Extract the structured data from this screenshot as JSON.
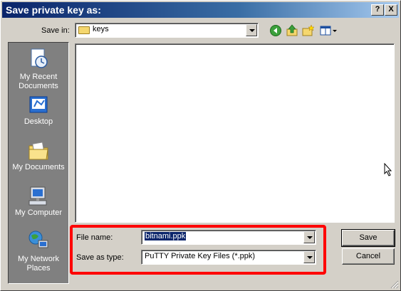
{
  "window": {
    "title": "Save private key as:",
    "help_label": "?",
    "close_label": "X"
  },
  "toolbar": {
    "save_in_label": "Save in:",
    "save_in_value": "keys"
  },
  "places": [
    {
      "label": "My Recent Documents",
      "icon": "recent-documents-icon"
    },
    {
      "label": "Desktop",
      "icon": "desktop-icon"
    },
    {
      "label": "My Documents",
      "icon": "my-documents-icon"
    },
    {
      "label": "My Computer",
      "icon": "my-computer-icon"
    },
    {
      "label": "My Network Places",
      "icon": "network-places-icon"
    }
  ],
  "form": {
    "filename_label": "File name:",
    "filename_value": "bitnami.ppk",
    "type_label": "Save as type:",
    "type_value": "PuTTY Private Key Files (*.ppk)"
  },
  "buttons": {
    "save": "Save",
    "cancel": "Cancel"
  },
  "colors": {
    "highlight": "#ff0000",
    "title_bar": "#0a246a",
    "dialog_bg": "#d4d0c8"
  }
}
